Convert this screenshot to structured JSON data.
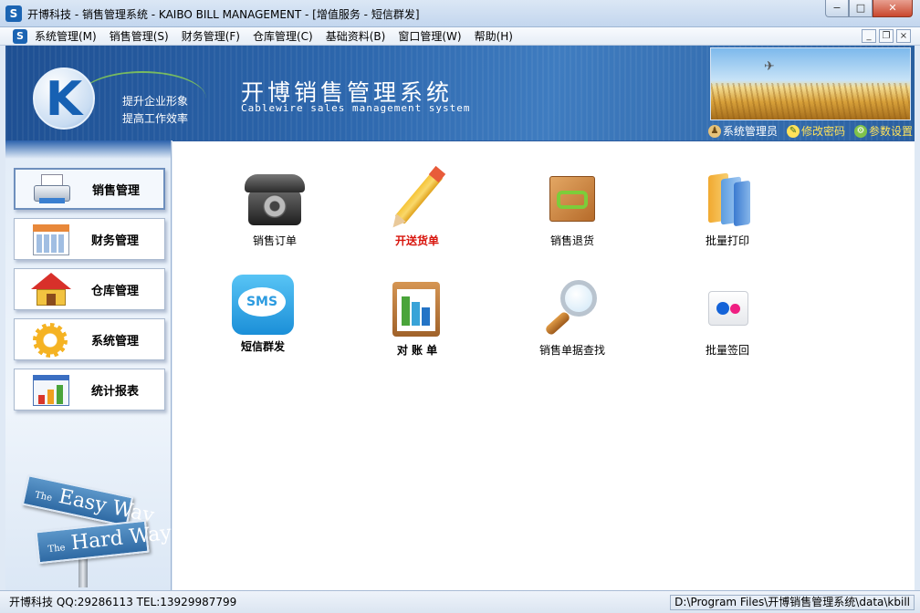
{
  "window": {
    "title": "开博科技 - 销售管理系统 - KAIBO BILL MANAGEMENT - [增值服务 - 短信群发]",
    "app_icon": "S",
    "buttons": {
      "minimize": "−",
      "maximize": "□",
      "close": "✕"
    }
  },
  "menubar": {
    "icon": "S",
    "items": [
      {
        "label": "系统管理(M)"
      },
      {
        "label": "销售管理(S)"
      },
      {
        "label": "财务管理(F)"
      },
      {
        "label": "仓库管理(C)"
      },
      {
        "label": "基础资料(B)"
      },
      {
        "label": "窗口管理(W)"
      },
      {
        "label": "帮助(H)"
      }
    ],
    "mdi_buttons": {
      "minimize": "_",
      "restore": "❐",
      "close": "×"
    }
  },
  "banner": {
    "logo_letter": "K",
    "slogan_line1": "提升企业形象",
    "slogan_line2": "提高工作效率",
    "title": "开博销售管理系统",
    "subtitle": "Cablewire sales management system",
    "user_links": [
      {
        "label": "系统管理员",
        "icon": "user-icon",
        "glyph": "♟"
      },
      {
        "label": "修改密码",
        "icon": "pencil-icon",
        "glyph": "✎"
      },
      {
        "label": "参数设置",
        "icon": "settings-icon",
        "glyph": "⚙"
      }
    ]
  },
  "sidebar": {
    "items": [
      {
        "label": "销售管理",
        "icon": "printer-icon",
        "active": true
      },
      {
        "label": "财务管理",
        "icon": "calendar-icon",
        "active": false
      },
      {
        "label": "仓库管理",
        "icon": "house-icon",
        "active": false
      },
      {
        "label": "系统管理",
        "icon": "gear-icon",
        "active": false
      },
      {
        "label": "统计报表",
        "icon": "bar-chart-icon",
        "active": false
      }
    ],
    "street_sign": {
      "line1_prefix": "The",
      "line1": "Easy Way",
      "line2_prefix": "The",
      "line2": "Hard Way"
    }
  },
  "main": {
    "functions": [
      {
        "label": "销售订单",
        "icon": "telephone-icon"
      },
      {
        "label": "开送货单",
        "icon": "pencil-icon",
        "highlight": true
      },
      {
        "label": "销售退货",
        "icon": "return-box-icon"
      },
      {
        "label": "批量打印",
        "icon": "folders-icon"
      },
      {
        "label": "短信群发",
        "icon": "sms-icon",
        "icon_text": "SMS"
      },
      {
        "label": "对 账 单",
        "icon": "clipboard-chart-icon"
      },
      {
        "label": "销售单据查找",
        "icon": "magnifier-icon"
      },
      {
        "label": "批量签回",
        "icon": "flickr-dots-icon"
      }
    ]
  },
  "statusbar": {
    "left": "开博科技 QQ:29286113 TEL:13929987799",
    "right": "D:\\Program Files\\开博销售管理系统\\data\\kbill"
  },
  "colors": {
    "banner_blue": "#2d67ad",
    "highlight_red": "#d8140c",
    "link_yellow": "#ffe25a"
  }
}
